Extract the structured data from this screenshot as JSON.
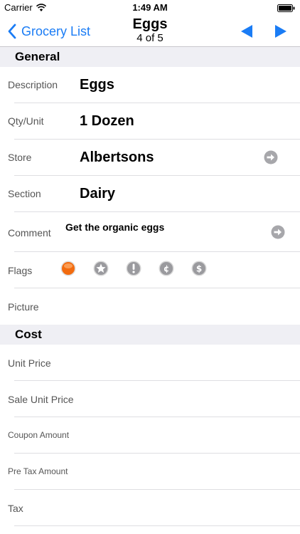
{
  "status_bar": {
    "carrier": "Carrier",
    "time": "1:49 AM"
  },
  "nav": {
    "back_label": "Grocery List",
    "title": "Eggs",
    "subtitle": "4 of 5",
    "accent_color": "#1a7cf5"
  },
  "sections": {
    "general": "General",
    "cost": "Cost"
  },
  "general": {
    "description": {
      "label": "Description",
      "value": "Eggs"
    },
    "qty_unit": {
      "label": "Qty/Unit",
      "value": "1 Dozen"
    },
    "store": {
      "label": "Store",
      "value": "Albertsons"
    },
    "section": {
      "label": "Section",
      "value": "Dairy"
    },
    "comment": {
      "label": "Comment",
      "value": "Get the organic eggs"
    },
    "flags": {
      "label": "Flags",
      "items": [
        "orange-dot-flag",
        "star-flag",
        "exclamation-flag",
        "cent-flag",
        "dollar-flag"
      ],
      "active": "orange-dot-flag"
    },
    "picture": {
      "label": "Picture"
    }
  },
  "cost": {
    "unit_price": {
      "label": "Unit Price"
    },
    "sale_unit_price": {
      "label": "Sale Unit Price"
    },
    "coupon_amount": {
      "label": "Coupon Amount"
    },
    "pre_tax_amount": {
      "label": "Pre Tax Amount"
    },
    "tax": {
      "label": "Tax"
    }
  }
}
